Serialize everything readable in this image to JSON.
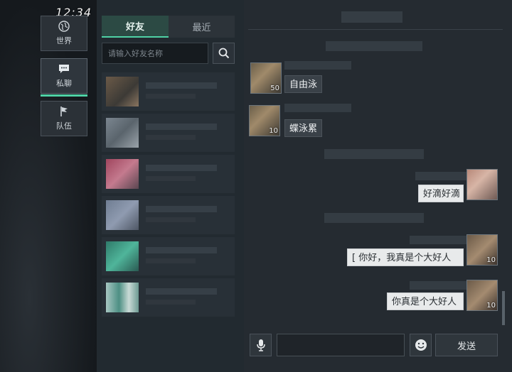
{
  "clock": "12:34",
  "nav": [
    {
      "label": "世界",
      "icon": "globe-icon"
    },
    {
      "label": "私聊",
      "icon": "chat-icon",
      "active": true
    },
    {
      "label": "队伍",
      "icon": "flag-icon"
    }
  ],
  "tabs": {
    "friends": "好友",
    "recent": "最近"
  },
  "search": {
    "placeholder": "请输入好友名称"
  },
  "messages": [
    {
      "text": "自由泳",
      "side": "left",
      "level": "50"
    },
    {
      "text": "蝶泳累",
      "side": "left",
      "level": "10"
    },
    {
      "text": "好滴好滴",
      "side": "right",
      "level": ""
    },
    {
      "text": "[ 你好，我真是个大好人",
      "side": "right",
      "level": "10"
    },
    {
      "text": "你真是个大好人",
      "side": "right",
      "level": "10"
    }
  ],
  "send_label": "发送",
  "colors": {
    "accent": "#4fd1a5",
    "panel": "#222a30",
    "chat_bg": "#252b31"
  }
}
